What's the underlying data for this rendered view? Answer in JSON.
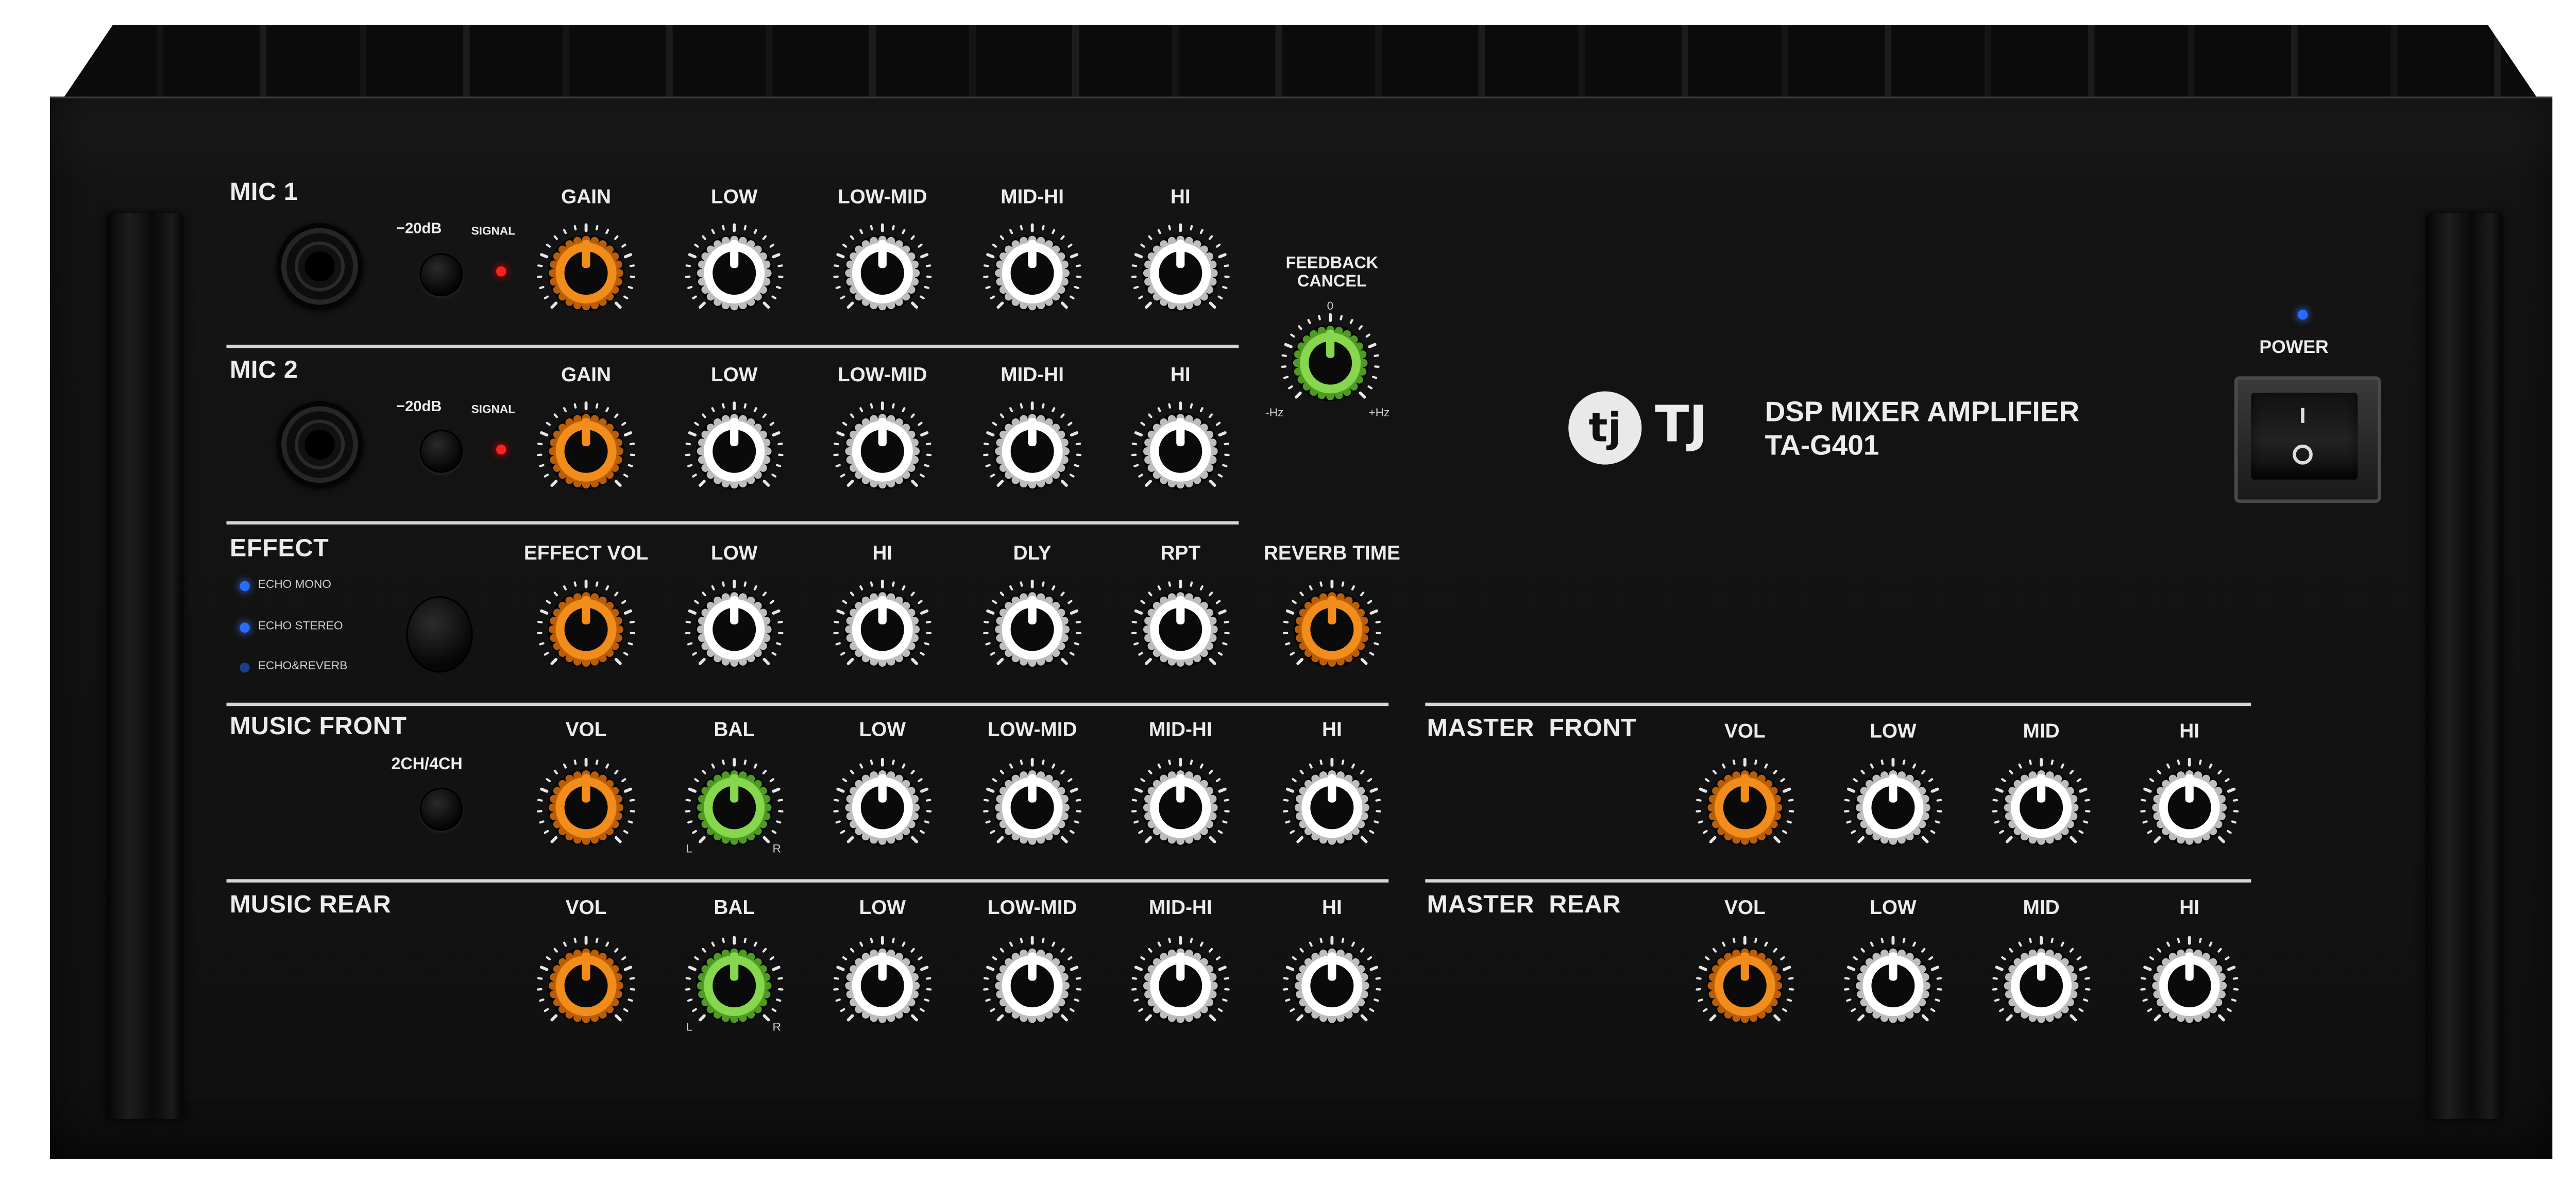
{
  "colors": {
    "panel": "#121212",
    "text": "#ececec",
    "knob_orange": "#f28c1a",
    "knob_white": "#ffffff",
    "knob_green": "#86d64e",
    "led_red": "#ff2020",
    "led_blue": "#2a6bff"
  },
  "brand": {
    "logo_mark": "tj",
    "name": "TJ",
    "product": "DSP MIXER AMPLIFIER",
    "model": "TA-G401"
  },
  "power": {
    "label": "POWER",
    "on_symbol": "I",
    "off_symbol": "O"
  },
  "mic1": {
    "title": "MIC 1",
    "pad_label": "−20dB",
    "signal_label": "SIGNAL",
    "knobs": [
      {
        "label": "GAIN",
        "color": "orange"
      },
      {
        "label": "LOW",
        "color": "white"
      },
      {
        "label": "LOW-MID",
        "color": "white"
      },
      {
        "label": "MID-HI",
        "color": "white"
      },
      {
        "label": "HI",
        "color": "white"
      }
    ]
  },
  "mic2": {
    "title": "MIC 2",
    "pad_label": "−20dB",
    "signal_label": "SIGNAL",
    "knobs": [
      {
        "label": "GAIN",
        "color": "orange"
      },
      {
        "label": "LOW",
        "color": "white"
      },
      {
        "label": "LOW-MID",
        "color": "white"
      },
      {
        "label": "MID-HI",
        "color": "white"
      },
      {
        "label": "HI",
        "color": "white"
      }
    ]
  },
  "feedback": {
    "title_line1": "FEEDBACK",
    "title_line2": "CANCEL",
    "zero": "0",
    "minus": "-Hz",
    "plus": "+Hz",
    "color": "green"
  },
  "effect": {
    "title": "EFFECT",
    "modes": [
      {
        "label": "ECHO MONO",
        "led": "on"
      },
      {
        "label": "ECHO STEREO",
        "led": "on"
      },
      {
        "label": "ECHO&REVERB",
        "led": "dim"
      }
    ],
    "knobs": [
      {
        "label": "EFFECT VOL",
        "color": "orange"
      },
      {
        "label": "LOW",
        "color": "white"
      },
      {
        "label": "HI",
        "color": "white"
      },
      {
        "label": "DLY",
        "color": "white"
      },
      {
        "label": "RPT",
        "color": "white"
      },
      {
        "label": "REVERB TIME",
        "color": "orange"
      }
    ]
  },
  "music_front": {
    "title": "MUSIC FRONT",
    "switch_label": "2CH/4CH",
    "knobs": [
      {
        "label": "VOL",
        "color": "orange"
      },
      {
        "label": "BAL",
        "color": "green"
      },
      {
        "label": "LOW",
        "color": "white"
      },
      {
        "label": "LOW-MID",
        "color": "white"
      },
      {
        "label": "MID-HI",
        "color": "white"
      },
      {
        "label": "HI",
        "color": "white"
      }
    ],
    "bal_left": "L",
    "bal_right": "R"
  },
  "music_rear": {
    "title": "MUSIC REAR",
    "knobs": [
      {
        "label": "VOL",
        "color": "orange"
      },
      {
        "label": "BAL",
        "color": "green"
      },
      {
        "label": "LOW",
        "color": "white"
      },
      {
        "label": "LOW-MID",
        "color": "white"
      },
      {
        "label": "MID-HI",
        "color": "white"
      },
      {
        "label": "HI",
        "color": "white"
      }
    ],
    "bal_left": "L",
    "bal_right": "R"
  },
  "master_front": {
    "title": "MASTER  FRONT",
    "knobs": [
      {
        "label": "VOL",
        "color": "orange"
      },
      {
        "label": "LOW",
        "color": "white"
      },
      {
        "label": "MID",
        "color": "white"
      },
      {
        "label": "HI",
        "color": "white"
      }
    ]
  },
  "master_rear": {
    "title": "MASTER  REAR",
    "knobs": [
      {
        "label": "VOL",
        "color": "orange"
      },
      {
        "label": "LOW",
        "color": "white"
      },
      {
        "label": "MID",
        "color": "white"
      },
      {
        "label": "HI",
        "color": "white"
      }
    ]
  }
}
